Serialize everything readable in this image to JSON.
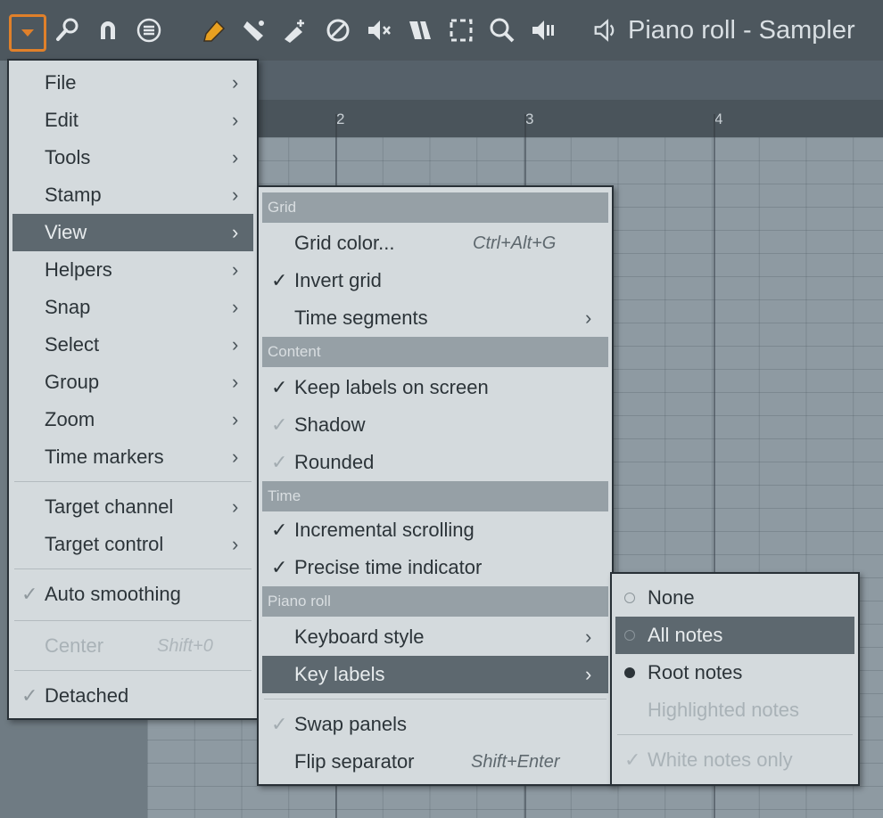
{
  "toolbar": {
    "icons": [
      "menu-dropdown-icon",
      "wrench-icon",
      "magnet-icon",
      "list-icon",
      "pencil-icon",
      "paint-icon",
      "delete-icon",
      "mute-slash-icon",
      "mute-speaker-icon",
      "slice-icon",
      "select-icon",
      "zoom-icon",
      "playback-icon"
    ],
    "title": "Piano roll - Sampler"
  },
  "ruler": {
    "bars": [
      "2",
      "3",
      "4"
    ]
  },
  "main_menu": {
    "items": [
      {
        "label": "File",
        "submenu": true
      },
      {
        "label": "Edit",
        "submenu": true
      },
      {
        "label": "Tools",
        "submenu": true
      },
      {
        "label": "Stamp",
        "submenu": true
      },
      {
        "label": "View",
        "submenu": true,
        "highlighted": true
      },
      {
        "label": "Helpers",
        "submenu": true
      },
      {
        "label": "Snap",
        "submenu": true
      },
      {
        "label": "Select",
        "submenu": true
      },
      {
        "label": "Group",
        "submenu": true
      },
      {
        "label": "Zoom",
        "submenu": true
      },
      {
        "label": "Time markers",
        "submenu": true
      },
      {
        "label": "Target channel",
        "submenu": true
      },
      {
        "label": "Target control",
        "submenu": true
      },
      {
        "label": "Auto smoothing",
        "checked": true
      },
      {
        "label": "Center",
        "shortcut": "Shift+0",
        "disabled": true
      },
      {
        "label": "Detached",
        "checked": true
      }
    ]
  },
  "view_menu": {
    "sections": [
      "Grid",
      "Content",
      "Time",
      "Piano roll"
    ],
    "items": [
      {
        "label": "Grid color...",
        "shortcut": "Ctrl+Alt+G"
      },
      {
        "label": "Invert grid",
        "checked": true
      },
      {
        "label": "Time segments",
        "submenu": true
      },
      {
        "label": "Keep labels on screen",
        "checked": true
      },
      {
        "label": "Shadow",
        "checked": true,
        "faded_check": true
      },
      {
        "label": "Rounded",
        "checked": true,
        "faded_check": true
      },
      {
        "label": "Incremental scrolling",
        "checked": true
      },
      {
        "label": "Precise time indicator",
        "checked": true
      },
      {
        "label": "Keyboard style",
        "submenu": true
      },
      {
        "label": "Key labels",
        "submenu": true,
        "highlighted": true
      },
      {
        "label": "Swap panels",
        "checked": true,
        "faded_check": true
      },
      {
        "label": "Flip separator",
        "shortcut": "Shift+Enter"
      }
    ]
  },
  "key_labels_menu": {
    "items": [
      {
        "label": "None",
        "radio": false
      },
      {
        "label": "All notes",
        "radio": false,
        "highlighted": true
      },
      {
        "label": "Root notes",
        "radio": true
      },
      {
        "label": "Highlighted notes",
        "disabled": true
      },
      {
        "label": "White notes only",
        "checked": true,
        "disabled": true
      }
    ]
  },
  "glyphs": {
    "arrow": "›",
    "check": "✓"
  },
  "colors": {
    "accent": "#e0802a",
    "menu_bg": "#d4dadd",
    "highlight": "#5d686f",
    "section": "#96a0a6"
  }
}
